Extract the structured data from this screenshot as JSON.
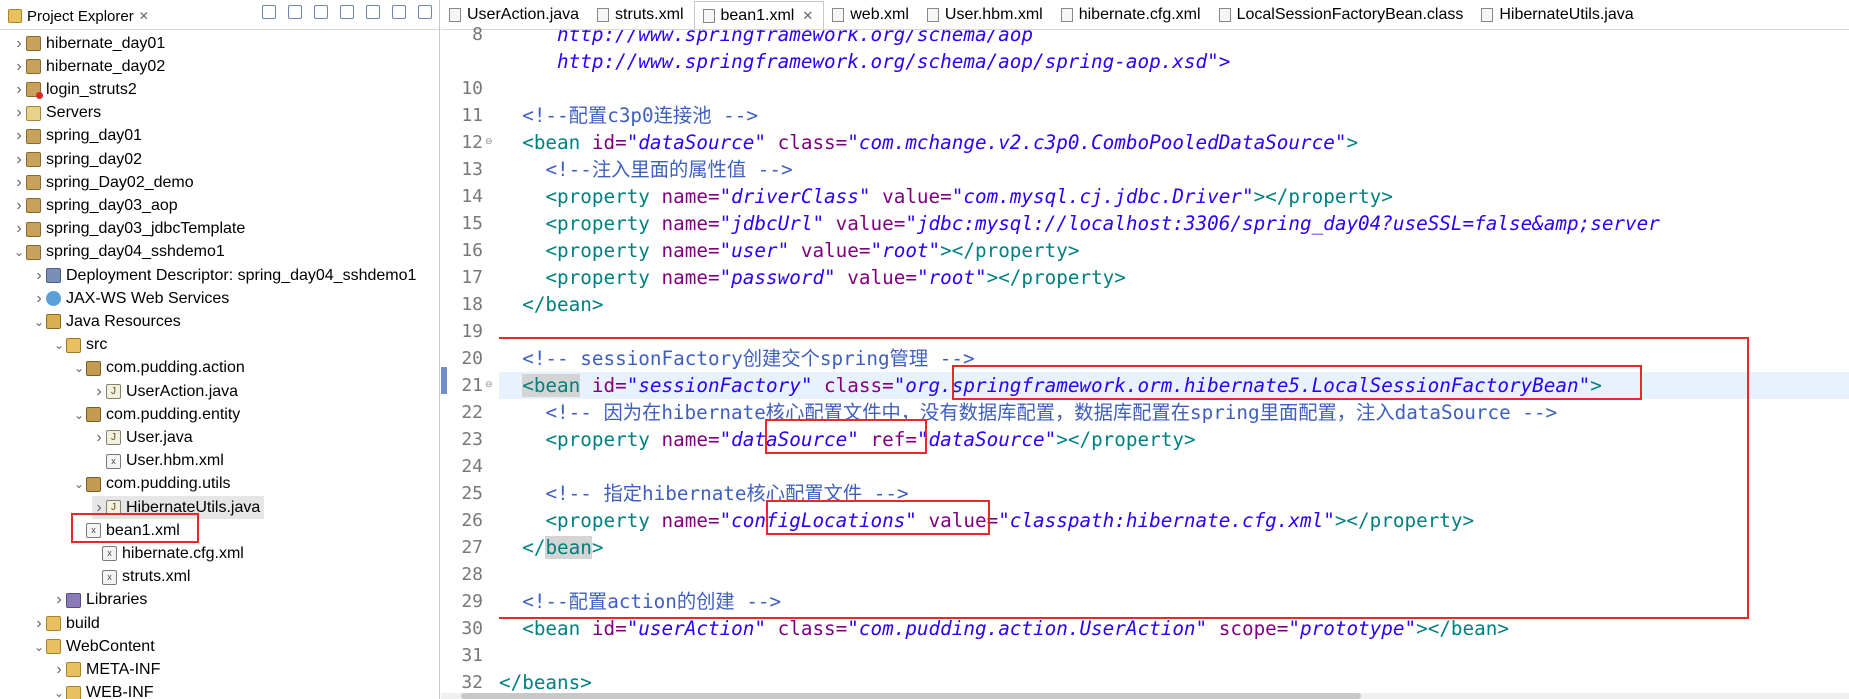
{
  "explorer": {
    "title": "Project Explorer",
    "close_glyph": "✕",
    "items": [
      {
        "label": "hibernate_day01",
        "icon": "project-icon"
      },
      {
        "label": "hibernate_day02",
        "icon": "project-icon"
      },
      {
        "label": "login_struts2",
        "icon": "project-error-icon"
      },
      {
        "label": "Servers",
        "icon": "servers-icon"
      },
      {
        "label": "spring_day01",
        "icon": "project-icon"
      },
      {
        "label": "spring_day02",
        "icon": "project-icon"
      },
      {
        "label": "spring_Day02_demo",
        "icon": "project-icon"
      },
      {
        "label": "spring_day03_aop",
        "icon": "project-icon"
      },
      {
        "label": "spring_day03_jdbcTemplate",
        "icon": "project-icon"
      },
      {
        "label": "spring_day04_sshdemo1",
        "icon": "project-icon"
      },
      {
        "label": "Deployment Descriptor: spring_day04_sshdemo1",
        "icon": "deployment-descriptor-icon"
      },
      {
        "label": "JAX-WS Web Services",
        "icon": "web-services-icon"
      },
      {
        "label": "Java Resources",
        "icon": "java-resources-icon"
      },
      {
        "label": "src",
        "icon": "source-folder-icon"
      },
      {
        "label": "com.pudding.action",
        "icon": "package-icon"
      },
      {
        "label": "UserAction.java",
        "icon": "java-file-icon"
      },
      {
        "label": "com.pudding.entity",
        "icon": "package-icon"
      },
      {
        "label": "User.java",
        "icon": "java-file-icon"
      },
      {
        "label": "User.hbm.xml",
        "icon": "xml-file-icon"
      },
      {
        "label": "com.pudding.utils",
        "icon": "package-icon"
      },
      {
        "label": "HibernateUtils.java",
        "icon": "java-file-icon"
      },
      {
        "label": "bean1.xml",
        "icon": "xml-file-icon"
      },
      {
        "label": "hibernate.cfg.xml",
        "icon": "xml-file-icon"
      },
      {
        "label": "struts.xml",
        "icon": "xml-file-icon"
      },
      {
        "label": "Libraries",
        "icon": "libraries-icon"
      },
      {
        "label": "build",
        "icon": "folder-icon"
      },
      {
        "label": "WebContent",
        "icon": "folder-icon"
      },
      {
        "label": "META-INF",
        "icon": "folder-icon"
      },
      {
        "label": "WEB-INF",
        "icon": "folder-icon"
      }
    ]
  },
  "tabs": [
    {
      "label": "UserAction.java",
      "active": false
    },
    {
      "label": "struts.xml",
      "active": false
    },
    {
      "label": "bean1.xml",
      "active": true
    },
    {
      "label": "web.xml",
      "active": false
    },
    {
      "label": "User.hbm.xml",
      "active": false
    },
    {
      "label": "hibernate.cfg.xml",
      "active": false
    },
    {
      "label": "LocalSessionFactoryBean.class",
      "active": false
    },
    {
      "label": "HibernateUtils.java",
      "active": false
    }
  ],
  "tab_close_glyph": "✕",
  "line_numbers": [
    "8",
    "10",
    "11",
    "12",
    "13",
    "14",
    "15",
    "16",
    "17",
    "18",
    "19",
    "20",
    "21",
    "22",
    "23",
    "24",
    "25",
    "26",
    "27",
    "28",
    "29",
    "30",
    "31",
    "32"
  ],
  "code": {
    "l8": "http://www.springframework.org/schema/aop",
    "l9": "http://www.springframework.org/schema/aop/spring-aop.xsd\">",
    "l11_comment": "<!--配置c3p0连接池 -->",
    "l12_tag": "<bean",
    "l12_id_attr": "id=",
    "l12_id_val": "\"dataSource\"",
    "l12_class_attr": "class=",
    "l12_class_val": "\"com.mchange.v2.c3p0.ComboPooledDataSource\"",
    "l12_end": ">",
    "l13_comment": "<!--注入里面的属性值 -->",
    "l14_name_val": "\"driverClass\"",
    "l14_value_val": "\"com.mysql.cj.jdbc.Driver\"",
    "l15_name_val": "\"jdbcUrl\"",
    "l15_value_val": "\"jdbc:mysql://localhost:3306/spring_day04?useSSL=false&amp;server",
    "l16_name_val": "\"user\"",
    "l16_value_val": "\"root\"",
    "l17_name_val": "\"password\"",
    "l17_value_val": "\"root\"",
    "close_bean": "</bean>",
    "l20_comment": "<!-- sessionFactory创建交个spring管理 -->",
    "l21_id_val": "\"sessionFactory\"",
    "l21_class_val": "\"org.springframework.orm.hibernate5.LocalSessionFactoryBean\"",
    "l22_comment": "<!-- 因为在hibernate核心配置文件中，没有数据库配置，数据库配置在spring里面配置，注入dataSource -->",
    "l23_name_val": "\"dataSource\"",
    "l23_ref_attr": "ref=",
    "l23_ref_val": "\"dataSource\"",
    "l25_comment": "<!-- 指定hibernate核心配置文件 -->",
    "l26_name_val": "\"configLocations\"",
    "l26_value_val": "\"classpath:hibernate.cfg.xml\"",
    "l27_close_a": "</",
    "l27_close_b": "bean",
    "l27_close_c": ">",
    "l29_comment": "<!--配置action的创建 -->",
    "l30_id_val": "\"userAction\"",
    "l30_class_val": "\"com.pudding.action.UserAction\"",
    "l30_scope_attr": "scope=",
    "l30_scope_val": "\"prototype\"",
    "l30_end": "></bean>",
    "l32": "</beans>",
    "property_open": "<property",
    "name_attr": "name=",
    "value_attr": "value=",
    "property_close": "></property>",
    "bean_open": "<bean",
    "id_attr": "id=",
    "class_attr": "class=",
    "gt": ">"
  },
  "colors": {
    "annotation_red": "#e8282a",
    "current_line": "#e8f2fe",
    "string_blue": "#2a00ff",
    "attribute_purple": "#7f007f",
    "tag_teal": "#3f7f7f",
    "comment_blue": "#3f5fbf"
  }
}
